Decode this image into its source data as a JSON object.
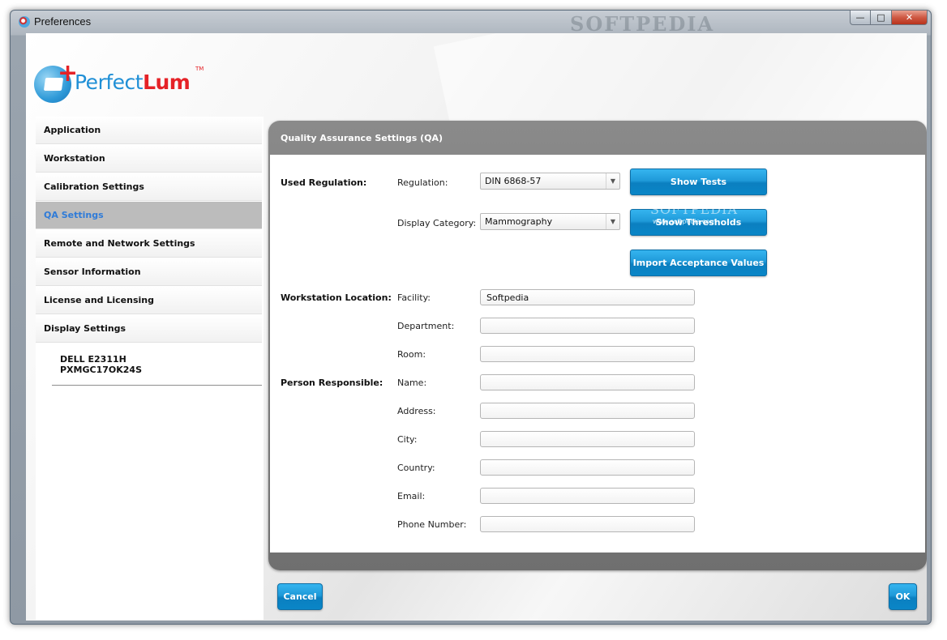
{
  "window": {
    "title": "Preferences",
    "icon": "perfectlum-app-icon",
    "watermark": "SOFTPEDIA",
    "controls": {
      "minimize": "—",
      "maximize": "□",
      "close": "✕"
    }
  },
  "logo": {
    "prefix": "Perfect",
    "suffix": "Lum",
    "plus": "+",
    "tm": "TM",
    "brand_blue": "#1f8fd6",
    "brand_red": "#e52227"
  },
  "sidebar": {
    "items": [
      {
        "label": "Application"
      },
      {
        "label": "Workstation"
      },
      {
        "label": "Calibration Settings"
      },
      {
        "label": "QA Settings"
      },
      {
        "label": "Remote and Network Settings"
      },
      {
        "label": "Sensor Information"
      },
      {
        "label": "License and Licensing"
      },
      {
        "label": "Display Settings"
      }
    ],
    "active_index": 3,
    "active_color": "#2f7bd8",
    "display": {
      "model": "DELL E2311H",
      "serial": "PXMGC17OK24S"
    }
  },
  "panel": {
    "title": "Quality Assurance Settings (QA)",
    "sections": {
      "used_regulation": "Used Regulation:",
      "workstation_location": "Workstation Location:",
      "person_responsible": "Person Responsible:"
    },
    "regulation": {
      "label": "Regulation:",
      "value": "DIN 6868-57"
    },
    "display_category": {
      "label": "Display Category:",
      "value": "Mammography"
    },
    "buttons": {
      "show_tests": "Show Tests",
      "show_thresholds": "Show Thresholds",
      "import_acceptance": "Import Acceptance Values"
    },
    "watermark": {
      "text": "SOFTPEDIA",
      "url": "www.softpedia.com"
    },
    "fields": {
      "facility": {
        "label": "Facility:",
        "value": "Softpedia"
      },
      "department": {
        "label": "Department:",
        "value": ""
      },
      "room": {
        "label": "Room:",
        "value": ""
      },
      "name": {
        "label": "Name:",
        "value": ""
      },
      "address": {
        "label": "Address:",
        "value": ""
      },
      "city": {
        "label": "City:",
        "value": ""
      },
      "country": {
        "label": "Country:",
        "value": ""
      },
      "email": {
        "label": "Email:",
        "value": ""
      },
      "phone": {
        "label": "Phone Number:",
        "value": ""
      }
    }
  },
  "footer": {
    "cancel": "Cancel",
    "ok": "OK",
    "button_color": "#1f9ad9"
  }
}
